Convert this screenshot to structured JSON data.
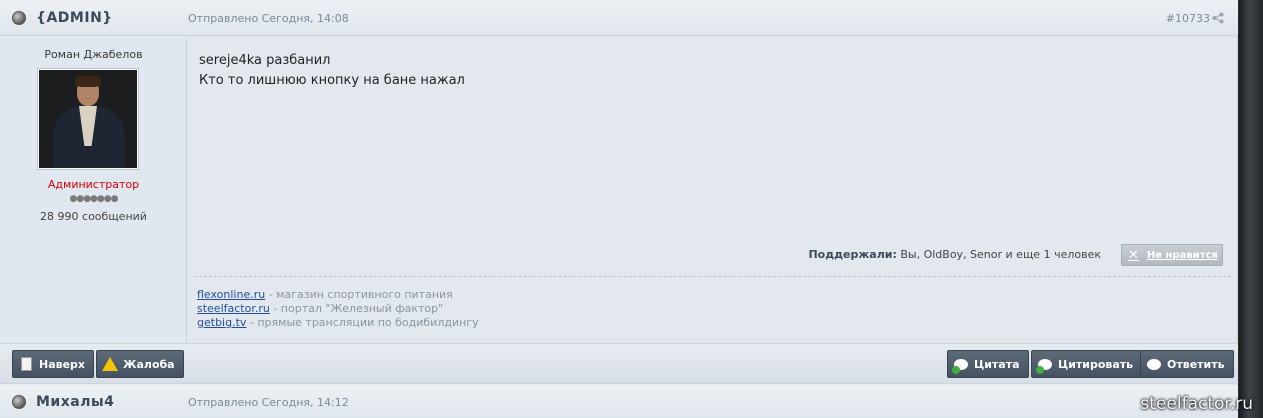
{
  "post": {
    "author": "{ADMIN}",
    "date": "Отправлено Сегодня, 14:08",
    "number": "#10733",
    "profile": {
      "name": "Роман Джабелов",
      "role": "Администратор",
      "rank_dots": "●●●●●●●",
      "messages": "28 990 сообщений"
    },
    "body": {
      "line1": "sereje4ka разбанил",
      "line2": "Кто то лишнюю кнопку на бане нажал"
    },
    "likes": {
      "label": "Поддержали:",
      "text": "Вы, OldBoy, Senor и еще 1 человек"
    },
    "dislike_label": "Не нравится",
    "signature": [
      {
        "link": "flexonline.ru",
        "desc": " - магазин спортивного питания"
      },
      {
        "link": "steelfactor.ru",
        "desc": " - портал \"Железный фактор\""
      },
      {
        "link": "getbig.tv",
        "desc": " - прямые трансляции по бодибилдингу"
      }
    ]
  },
  "footer": {
    "top_label": "Наверх",
    "report_label": "Жалоба",
    "quote_label": "Цитата",
    "multiquote_label": "Цитировать",
    "reply_label": "Ответить"
  },
  "next_post": {
    "author": "Михалы4",
    "date": "Отправлено Сегодня, 14:12"
  },
  "watermark": "steelfactor.ru",
  "icons": {
    "status": "status-dot-icon",
    "share": "share-icon",
    "dislike": "x-icon",
    "top": "document-icon",
    "report": "warning-icon",
    "quote": "quote-bubble-icon",
    "reply": "reply-bubble-icon"
  },
  "colors": {
    "role": "#d8000c",
    "link": "#1f4e9c",
    "button": "#4f5b69"
  }
}
